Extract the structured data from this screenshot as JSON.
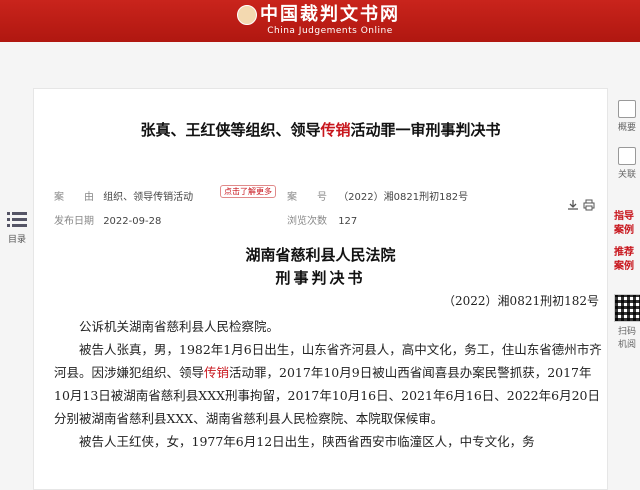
{
  "header": {
    "logo_cn": "中国裁判文书网",
    "logo_en": "China Judgements Online"
  },
  "document": {
    "title_part1": "张真、王红侠等组织、领导",
    "title_highlight": "传销",
    "title_part2": "活动罪一审刑事判决书",
    "meta": {
      "cause_label": "案　　由",
      "cause_value": "组织、领导传销活动",
      "more_tag": "点击了解更多",
      "caseno_label": "案　　号",
      "caseno_value": "（2022）湘0821刑初182号",
      "pubdate_label": "发布日期",
      "pubdate_value": "2022-09-28",
      "views_label": "浏览次数",
      "views_value": "127"
    },
    "court_name": "湖南省慈利县人民法院",
    "doc_type": "刑事判决书",
    "case_number": "（2022）湘0821刑初182号",
    "paragraphs": {
      "p1": "公诉机关湖南省慈利县人民检察院。",
      "p2_a": "被告人张真，男，1982年1月6日出生，山东省齐河县人，高中文化，务工，住山东省德州市齐河县。因涉嫌犯组织、领导",
      "p2_hl": "传销",
      "p2_b": "活动罪，2017年10月9日被山西省闻喜县办案民警抓获，2017年10月13日被湖南省慈利县XXX刑事拘留，2017年10月16日、2021年6月16日、2022年6月20日分别被湖南省慈利县XXX、湖南省慈利县人民检察院、本院取保候审。",
      "p3": "被告人王红侠，女，1977年6月12日出生，陕西省西安市临潼区人，中专文化，务"
    }
  },
  "sidebar_left": {
    "toc_label": "目录"
  },
  "sidebar_right": {
    "summary_label": "概要",
    "related_label": "关联",
    "guide_1": "指导",
    "guide_2": "案例",
    "recommend_1": "推荐",
    "recommend_2": "案例",
    "scan_1": "扫码",
    "scan_2": "机阅"
  }
}
